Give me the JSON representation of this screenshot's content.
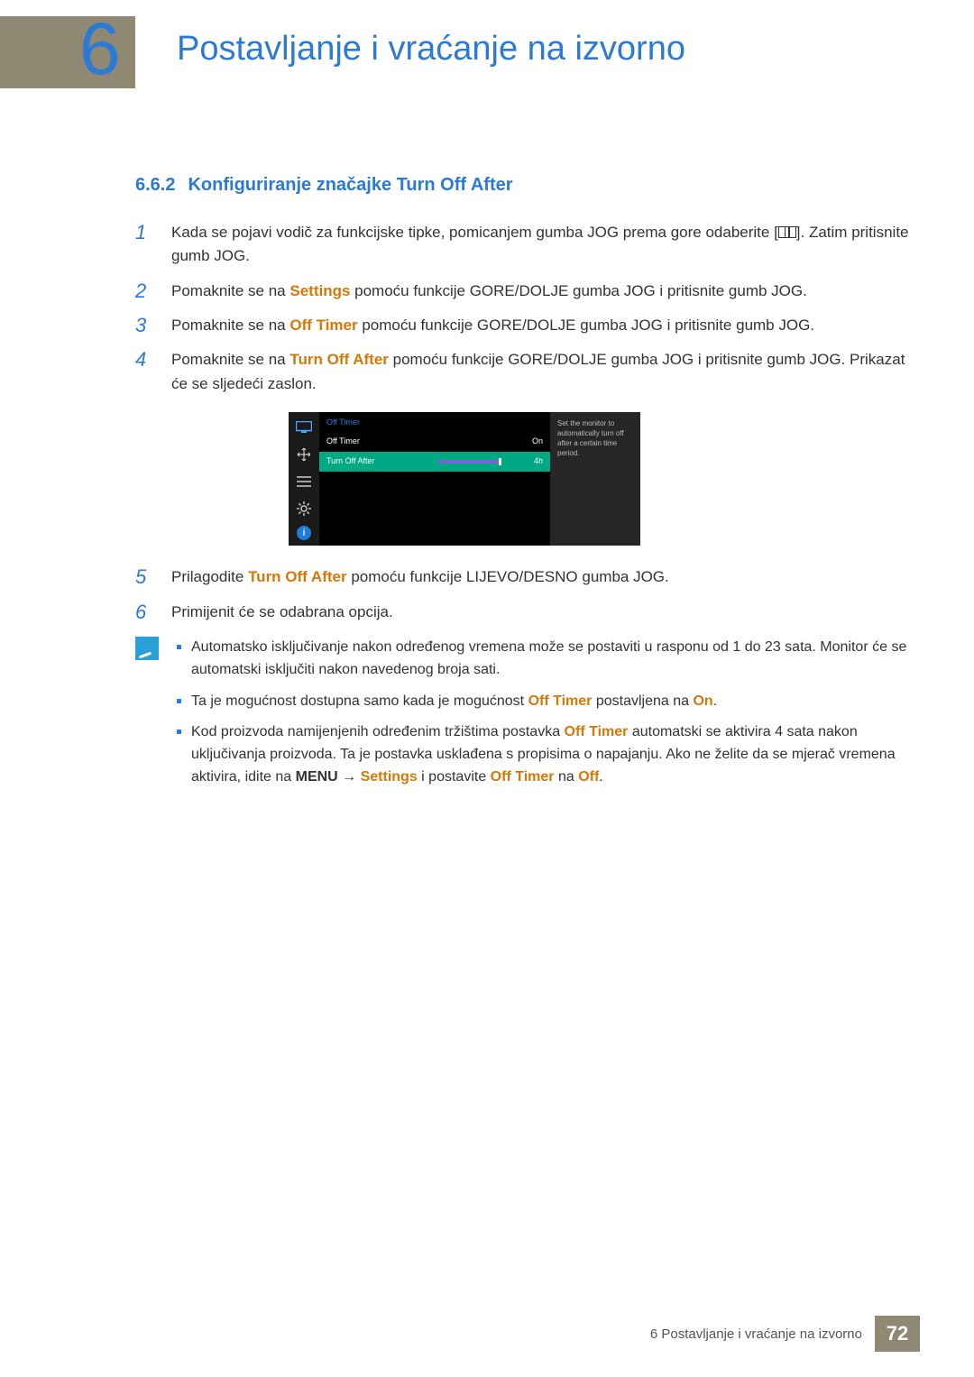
{
  "chapter": {
    "number": "6",
    "title": "Postavljanje i vraćanje na izvorno"
  },
  "section": {
    "number": "6.6.2",
    "title": "Konfiguriranje značajke Turn Off After"
  },
  "steps": {
    "s1": {
      "num": "1",
      "a": "Kada se pojavi vodič za funkcijske tipke, pomicanjem gumba JOG prema gore odaberite [",
      "b": "]. Zatim pritisnite gumb JOG."
    },
    "s2": {
      "num": "2",
      "a": "Pomaknite se na ",
      "settings": "Settings",
      "b": " pomoću funkcije GORE/DOLJE gumba JOG i pritisnite gumb JOG."
    },
    "s3": {
      "num": "3",
      "a": "Pomaknite se na ",
      "offtimer": "Off Timer",
      "b": " pomoću funkcije GORE/DOLJE gumba JOG i pritisnite gumb JOG."
    },
    "s4": {
      "num": "4",
      "a": "Pomaknite se na ",
      "toa": "Turn Off After",
      "b": " pomoću funkcije GORE/DOLJE gumba JOG i pritisnite gumb JOG. Prikazat će se sljedeći zaslon."
    },
    "s5": {
      "num": "5",
      "a": "Prilagodite ",
      "toa": "Turn Off After",
      "b": " pomoću funkcije LIJEVO/DESNO gumba JOG."
    },
    "s6": {
      "num": "6",
      "a": "Primijenit će se odabrana opcija."
    }
  },
  "osd": {
    "title": "Off Timer",
    "row1": {
      "label": "Off Timer",
      "value": "On"
    },
    "row2": {
      "label": "Turn Off After",
      "value": "4h"
    },
    "hint": "Set the monitor to automatically turn off after a certain time period."
  },
  "notes": {
    "n1": "Automatsko isključivanje nakon određenog vremena može se postaviti u rasponu od 1 do 23 sata. Monitor će se automatski isključiti nakon navedenog broja sati.",
    "n2": {
      "a": "Ta je mogućnost dostupna samo kada je mogućnost ",
      "offtimer": "Off Timer",
      "b": " postavljena na ",
      "on": "On",
      "c": "."
    },
    "n3": {
      "a": "Kod proizvoda namijenjenih određenim tržištima postavka ",
      "offtimer": "Off Timer",
      "b": " automatski se aktivira 4 sata nakon uključivanja proizvoda. Ta je postavka usklađena s propisima o napajanju. Ako ne želite da se mjerač vremena aktivira, idite na ",
      "menu": "MENU",
      "arrow": " → ",
      "settings": "Settings",
      "c": " i postavite ",
      "offtimer2": "Off Timer",
      "d": " na ",
      "off": "Off",
      "e": "."
    }
  },
  "footer": {
    "text": "6 Postavljanje i vraćanje na izvorno",
    "page": "72"
  }
}
